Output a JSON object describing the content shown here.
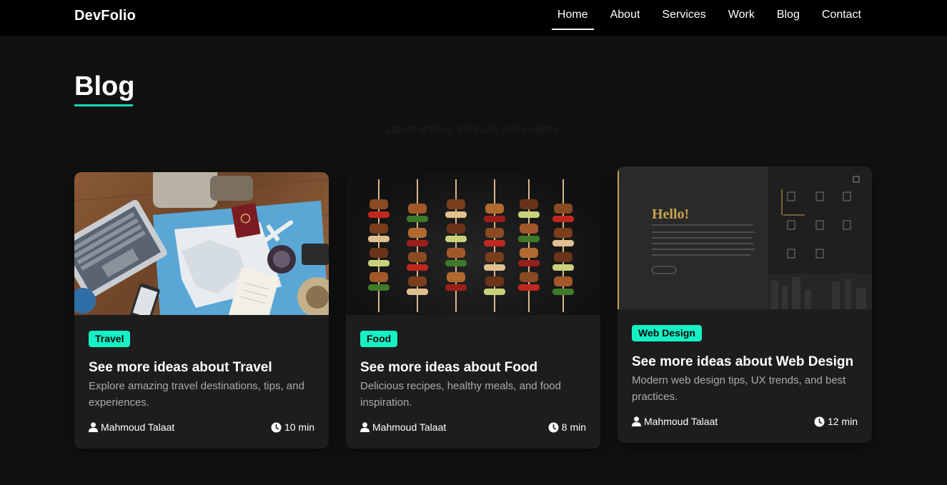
{
  "brand": "DevFolio",
  "nav": {
    "items": [
      {
        "label": "Home",
        "active": true
      },
      {
        "label": "About",
        "active": false
      },
      {
        "label": "Services",
        "active": false
      },
      {
        "label": "Work",
        "active": false
      },
      {
        "label": "Blog",
        "active": false
      },
      {
        "label": "Contact",
        "active": false
      }
    ]
  },
  "header": {
    "title": "Blog",
    "subtitle": "Latest articles, tutorials, and insights."
  },
  "colors": {
    "accent": "#16f0c4",
    "background": "#111111",
    "card": "#1d1d1d",
    "navbar": "#000000"
  },
  "cards": [
    {
      "image": "travel-flatlay-image",
      "tag": "Travel",
      "title": "See more ideas about Travel",
      "description": "Explore amazing travel destinations, tips, and experiences.",
      "author": "Mahmoud Talaat",
      "read_time": "10 min",
      "author_icon": "user-icon",
      "time_icon": "clock-icon"
    },
    {
      "image": "food-skewers-image",
      "tag": "Food",
      "title": "See more ideas about Food",
      "description": "Delicious recipes, healthy meals, and food inspiration.",
      "author": "Mahmoud Talaat",
      "read_time": "8 min",
      "author_icon": "user-icon",
      "time_icon": "clock-icon"
    },
    {
      "image": "web-design-mockup-image",
      "tag": "Web Design",
      "title": "See more ideas about Web Design",
      "description": "Modern web design tips, UX trends, and best practices.",
      "author": "Mahmoud Talaat",
      "read_time": "12 min",
      "author_icon": "user-icon",
      "time_icon": "clock-icon",
      "mockup_heading": "Hello!"
    }
  ]
}
